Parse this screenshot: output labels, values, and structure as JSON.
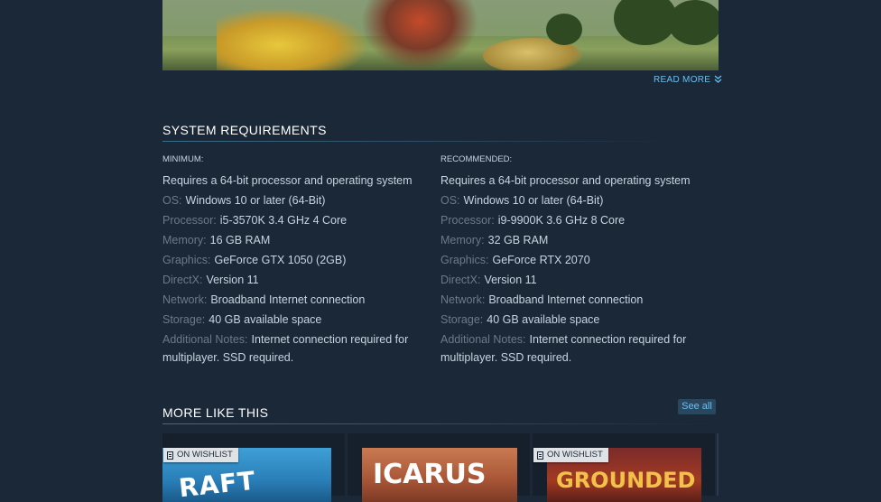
{
  "read_more": {
    "label": "READ MORE"
  },
  "sysreq": {
    "title": "SYSTEM REQUIREMENTS",
    "minimum": {
      "heading": "MINIMUM:",
      "intro": "Requires a 64-bit processor and operating system",
      "rows": [
        {
          "label": "OS:",
          "value": "Windows 10 or later (64-Bit)"
        },
        {
          "label": "Processor:",
          "value": "i5-3570K 3.4 GHz 4 Core"
        },
        {
          "label": "Memory:",
          "value": "16 GB RAM"
        },
        {
          "label": "Graphics:",
          "value": "GeForce GTX 1050 (2GB)"
        },
        {
          "label": "DirectX:",
          "value": "Version 11"
        },
        {
          "label": "Network:",
          "value": "Broadband Internet connection"
        },
        {
          "label": "Storage:",
          "value": "40 GB available space"
        },
        {
          "label": "Additional Notes:",
          "value": "Internet connection required for multiplayer. SSD required."
        }
      ]
    },
    "recommended": {
      "heading": "RECOMMENDED:",
      "intro": "Requires a 64-bit processor and operating system",
      "rows": [
        {
          "label": "OS:",
          "value": "Windows 10 or later (64-Bit)"
        },
        {
          "label": "Processor:",
          "value": "i9-9900K 3.6 GHz 8 Core"
        },
        {
          "label": "Memory:",
          "value": "32 GB RAM"
        },
        {
          "label": "Graphics:",
          "value": "GeForce RTX 2070"
        },
        {
          "label": "DirectX:",
          "value": "Version 11"
        },
        {
          "label": "Network:",
          "value": "Broadband Internet connection"
        },
        {
          "label": "Storage:",
          "value": "40 GB available space"
        },
        {
          "label": "Additional Notes:",
          "value": "Internet connection required for multiplayer. SSD required."
        }
      ]
    }
  },
  "more_like_this": {
    "title": "MORE LIKE THIS",
    "see_all": "See all",
    "cards": [
      {
        "wishlist": "ON WISHLIST",
        "logo": "RAFT"
      },
      {
        "wishlist": "",
        "logo": "ICARUS"
      },
      {
        "wishlist": "ON WISHLIST",
        "logo": "GROUNDED"
      }
    ]
  },
  "colors": {
    "accent": "#67c1f5",
    "background": "#1b2838"
  }
}
